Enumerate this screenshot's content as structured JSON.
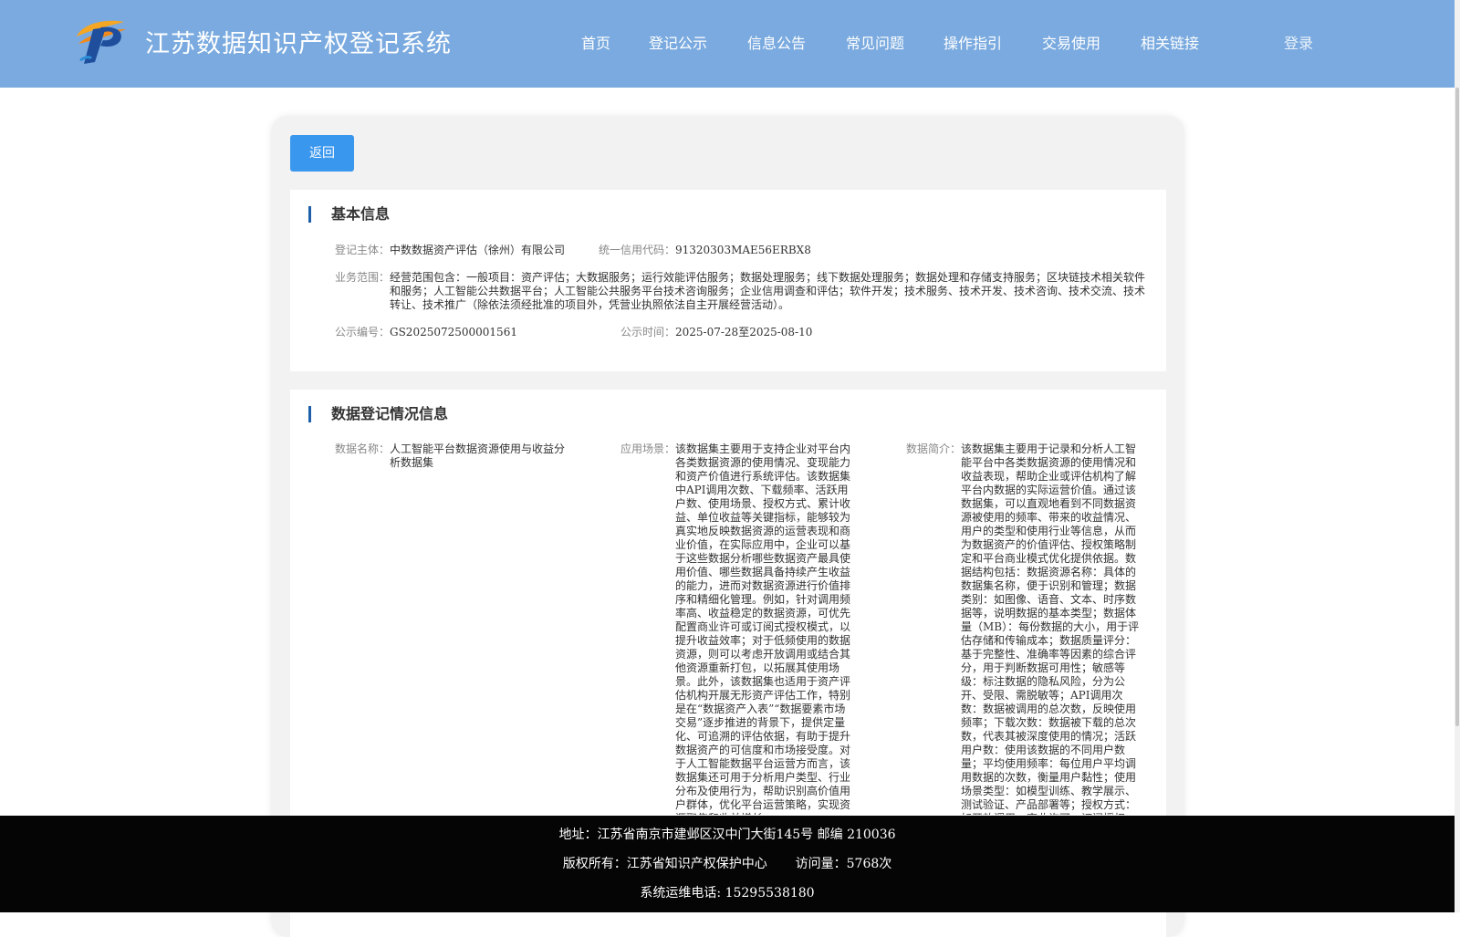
{
  "header": {
    "title": "江苏数据知识产权登记系统",
    "nav": [
      "首页",
      "登记公示",
      "信息公告",
      "常见问题",
      "操作指引",
      "交易使用",
      "相关链接"
    ],
    "login": "登录"
  },
  "back_button": "返回",
  "basic": {
    "title": "基本信息",
    "subject_label": "登记主体：",
    "subject": "中数数据资产评估（徐州）有限公司",
    "credit_label": "统一信用代码：",
    "credit": "91320303MAE56ERBX8",
    "scope_label": "业务范围：",
    "scope": "经营范围包含：一般项目：资产评估；大数据服务；运行效能评估服务；数据处理服务；线下数据处理服务；数据处理和存储支持服务；区块链技术相关软件和服务；人工智能公共数据平台；人工智能公共服务平台技术咨询服务；企业信用调查和评估；软件开发；技术服务、技术开发、技术咨询、技术交流、技术转让、技术推广（除依法须经批准的项目外，凭营业执照依法自主开展经营活动）。",
    "pub_no_label": "公示编号：",
    "pub_no": "GS2025072500001561",
    "pub_time_label": "公示时间：",
    "pub_time": "2025-07-28至2025-08-10"
  },
  "data_reg": {
    "title": "数据登记情况信息",
    "name_label": "数据名称：",
    "name": "人工智能平台数据资源使用与收益分析数据集",
    "scene_label": "应用场景：",
    "scene": "该数据集主要用于支持企业对平台内各类数据资源的使用情况、变现能力和资产价值进行系统评估。该数据集中API调用次数、下载频率、活跃用户数、使用场景、授权方式、累计收益、单位收益等关键指标，能够较为真实地反映数据资源的运营表现和商业价值，在实际应用中，企业可以基于这些数据分析哪些数据资产最具使用价值、哪些数据具备持续产生收益的能力，进而对数据资源进行价值排序和精细化管理。例如，针对调用频率高、收益稳定的数据资源，可优先配置商业许可或订阅式授权模式，以提升收益效率；对于低频使用的数据资源，则可以考虑开放调用或结合其他资源重新打包，以拓展其使用场景。此外，该数据集也适用于资产评估机构开展无形资产评估工作，特别是在“数据资产入表”“数据要素市场交易”逐步推进的背景下，提供定量化、可追溯的评估依据，有助于提升数据资产的可信度和市场接受度。对于人工智能数据平台运营方而言，该数据集还可用于分析用户类型、行业分布及使用行为，帮助识别高价值用户群体，优化平台运营策略，实现资源聚焦和收益增长。",
    "intro_label": "数据简介：",
    "intro": "该数据集主要用于记录和分析人工智能平台中各类数据资源的使用情况和收益表现，帮助企业或评估机构了解平台内数据的实际运营价值。通过该数据集，可以直观地看到不同数据资源被使用的频率、带来的收益情况、用户的类型和使用行业等信息，从而为数据资产的价值评估、授权策略制定和平台商业模式优化提供依据。数据结构包括：数据资源名称：具体的数据集名称，便于识别和管理；数据类别：如图像、语音、文本、时序数据等，说明数据的基本类型；数据体量（MB）：每份数据的大小，用于评估存储和传输成本；数据质量评分：基于完整性、准确率等因素的综合评分，用于判断数据可用性；敏感等级：标注数据的隐私风险，分为公开、受限、需脱敏等；API调用次数：数据被调用的总次数，反映使用频率；下载次数：数据被下载的总次数，代表其被深度使用的情况；活跃用户数：使用该数据的不同用户数量；平均使用频率：每位用户平均调用数据的次数，衡量用户黏性；使用场景类型：如模型训练、教学展示、测试验证、产品部署等；授权方式：如开放调用、商业许可、订阅授权等。"
  },
  "footer": {
    "address": "地址：江苏省南京市建邺区汉中门大街145号 邮编 210036",
    "copyright": "版权所有：江苏省知识产权保护中心",
    "visits": "访问量：5768次",
    "phone": "系统运维电话: 15295538180"
  },
  "colors": {
    "header_bg": "#7aaadf",
    "button_bg": "#3a97ee",
    "section_bar": "#1f5faa",
    "footer_bg": "#050505"
  }
}
